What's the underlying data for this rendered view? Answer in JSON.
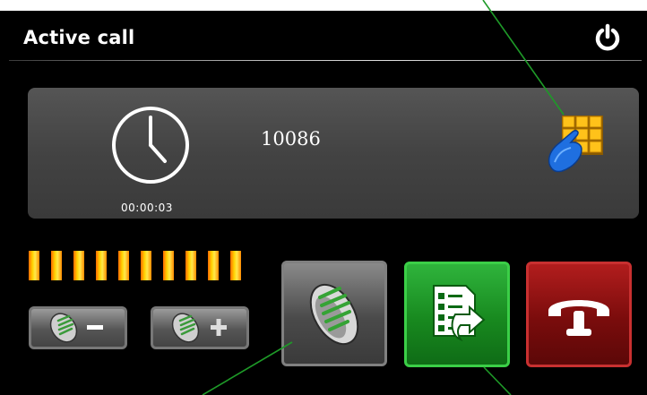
{
  "header": {
    "title": "Active call",
    "power_icon": "power-icon"
  },
  "call": {
    "number": "10086",
    "duration": "00:00:03",
    "clock_icon": "clock-icon",
    "keypad_icon": "keypad-icon"
  },
  "volume": {
    "level": 10,
    "max": 10
  },
  "buttons": {
    "volume_down_icon": "microphone-minus-icon",
    "volume_up_icon": "microphone-plus-icon",
    "mic_icon": "microphone-icon",
    "contacts_icon": "contacts-transfer-icon",
    "hangup_icon": "phone-hangup-icon"
  },
  "colors": {
    "background": "#000000",
    "panel": "#474747",
    "accept_green": "#1e9a28",
    "hangup_red": "#8a1010",
    "volume_orange": "#ffb000"
  }
}
